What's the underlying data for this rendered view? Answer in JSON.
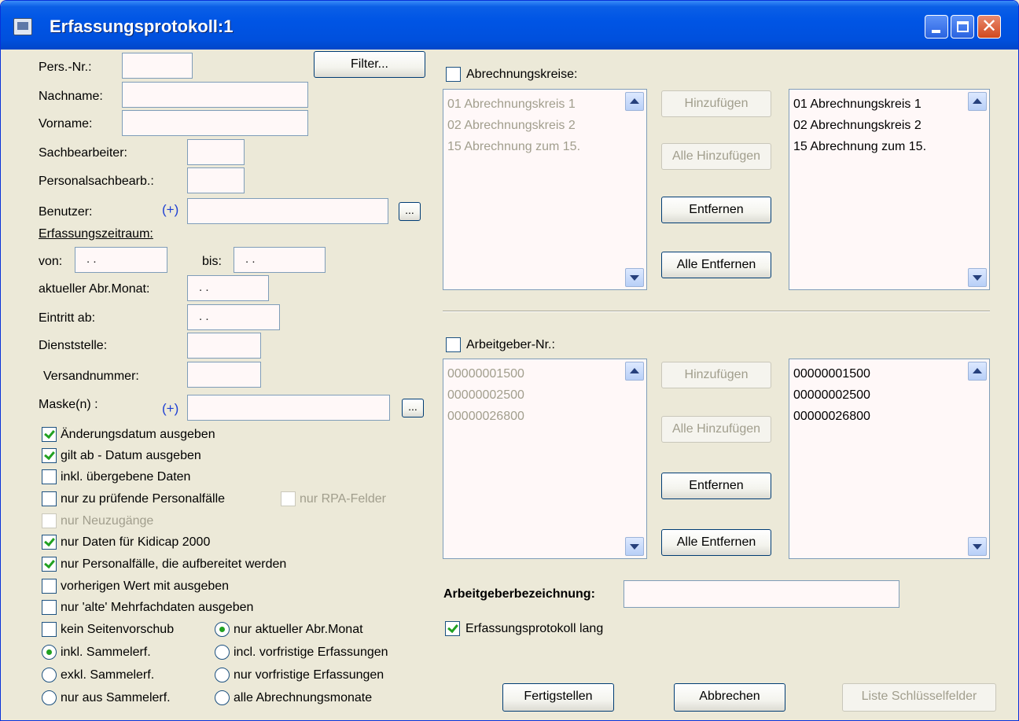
{
  "window": {
    "title": "Erfassungsprotokoll:1"
  },
  "left": {
    "pers_nr_label": "Pers.-Nr.:",
    "filter_button": "Filter...",
    "nachname_label": "Nachname:",
    "vorname_label": "Vorname:",
    "sachbearbeiter_label": "Sachbearbeiter:",
    "personalsachbearb_label": "Personalsachbearb.:",
    "benutzer_label": "Benutzer:",
    "plus_label": "(+)",
    "ellipsis": "...",
    "erfassungszeitraum_label": "Erfassungszeitraum:",
    "von_label": "von:",
    "von_value": ". .",
    "bis_label": "bis:",
    "bis_value": ". .",
    "abr_monat_label": "aktueller Abr.Monat:",
    "abr_monat_value": ". .",
    "eintritt_label": "Eintritt ab:",
    "eintritt_value": ". .",
    "dienststelle_label": "Dienststelle:",
    "versandnummer_label": "Versandnummer:",
    "maske_label": "Maske(n) :"
  },
  "checkboxes": [
    {
      "label": "Änderungsdatum ausgeben",
      "checked": true
    },
    {
      "label": "gilt ab - Datum ausgeben",
      "checked": true
    },
    {
      "label": "inkl. übergebene Daten",
      "checked": false
    },
    {
      "label": "nur zu prüfende Personalfälle",
      "checked": false
    },
    {
      "label": "nur RPA-Felder",
      "checked": false,
      "disabled": true
    },
    {
      "label": "nur Neuzugänge",
      "checked": false,
      "disabled": true
    },
    {
      "label": "nur Daten für Kidicap 2000",
      "checked": true
    },
    {
      "label": "nur Personalfälle, die aufbereitet werden",
      "checked": true
    },
    {
      "label": "vorherigen Wert mit ausgeben",
      "checked": false
    },
    {
      "label": "nur 'alte' Mehrfachdaten ausgeben",
      "checked": false
    },
    {
      "label": "kein Seitenvorschub",
      "checked": false
    }
  ],
  "radios_left": [
    {
      "label": "inkl. Sammelerf.",
      "selected": true
    },
    {
      "label": "exkl. Sammelerf.",
      "selected": false
    },
    {
      "label": "nur aus Sammelerf.",
      "selected": false
    }
  ],
  "radios_right": [
    {
      "label": "nur aktueller Abr.Monat",
      "selected": true
    },
    {
      "label": "incl. vorfristige Erfassungen",
      "selected": false
    },
    {
      "label": "nur vorfristige Erfassungen",
      "selected": false
    },
    {
      "label": "alle Abrechnungsmonate",
      "selected": false
    }
  ],
  "abrechnungskreise": {
    "label": "Abrechnungskreise:",
    "available": [
      "01 Abrechnungskreis 1",
      "02 Abrechnungskreis 2",
      "15 Abrechnung zum 15."
    ],
    "selected": [
      "01 Abrechnungskreis 1",
      "02 Abrechnungskreis 2",
      "15 Abrechnung zum 15."
    ]
  },
  "arbeitgeber": {
    "label": "Arbeitgeber-Nr.:",
    "available": [
      "00000001500",
      "00000002500",
      "00000026800"
    ],
    "selected": [
      "00000001500",
      "00000002500",
      "00000026800"
    ]
  },
  "buttons": {
    "hinzufuegen": "Hinzufügen",
    "alle_hinzufuegen": "Alle Hinzufügen",
    "entfernen": "Entfernen",
    "alle_entfernen": "Alle Entfernen",
    "fertigstellen": "Fertigstellen",
    "abbrechen": "Abbrechen",
    "liste_schluesselfelder": "Liste Schlüsselfelder"
  },
  "arbeitgeberbezeichnung_label": "Arbeitgeberbezeichnung:",
  "erfassungsprotokoll_lang": {
    "label": "Erfassungsprotokoll lang",
    "checked": true
  },
  "colors": {
    "titlebar": "#0055e5",
    "dialog_bg": "#ece9d8",
    "check_green": "#21a121",
    "field_border": "#7f9db9"
  }
}
